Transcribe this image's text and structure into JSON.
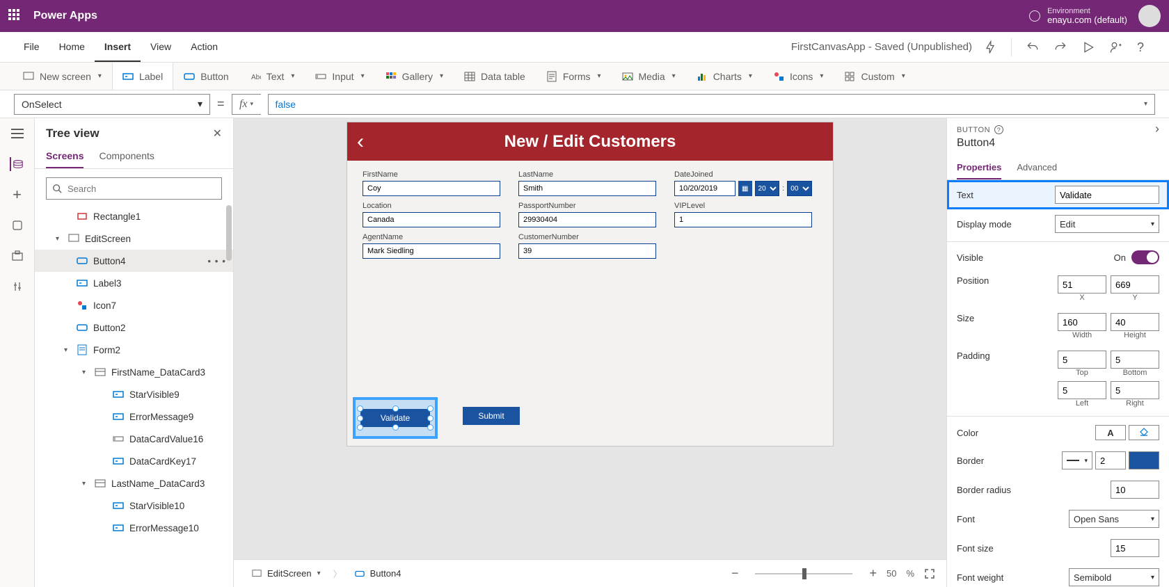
{
  "header": {
    "appName": "Power Apps",
    "envLabel": "Environment",
    "envValue": "enayu.com (default)"
  },
  "menu": {
    "items": [
      "File",
      "Home",
      "Insert",
      "View",
      "Action"
    ],
    "active": "Insert",
    "appStatus": "FirstCanvasApp - Saved (Unpublished)"
  },
  "ribbon": {
    "newScreen": "New screen",
    "label": "Label",
    "button": "Button",
    "text": "Text",
    "input": "Input",
    "gallery": "Gallery",
    "dataTable": "Data table",
    "forms": "Forms",
    "media": "Media",
    "charts": "Charts",
    "icons": "Icons",
    "custom": "Custom"
  },
  "formula": {
    "property": "OnSelect",
    "value": "false"
  },
  "tree": {
    "title": "Tree view",
    "tabs": [
      "Screens",
      "Components"
    ],
    "activeTab": "Screens",
    "searchPlaceholder": "Search",
    "items": [
      {
        "label": "Rectangle1",
        "indent": 1,
        "icon": "rect"
      },
      {
        "label": "EditScreen",
        "indent": 0,
        "icon": "screen",
        "caret": "down"
      },
      {
        "label": "Button4",
        "indent": 1,
        "icon": "button",
        "selected": true,
        "dots": true
      },
      {
        "label": "Label3",
        "indent": 1,
        "icon": "label"
      },
      {
        "label": "Icon7",
        "indent": 1,
        "icon": "icon"
      },
      {
        "label": "Button2",
        "indent": 1,
        "icon": "button"
      },
      {
        "label": "Form2",
        "indent": 1,
        "icon": "form",
        "caret": "down"
      },
      {
        "label": "FirstName_DataCard3",
        "indent": 2,
        "icon": "card",
        "caret": "down"
      },
      {
        "label": "StarVisible9",
        "indent": 3,
        "icon": "label"
      },
      {
        "label": "ErrorMessage9",
        "indent": 3,
        "icon": "label"
      },
      {
        "label": "DataCardValue16",
        "indent": 3,
        "icon": "input"
      },
      {
        "label": "DataCardKey17",
        "indent": 3,
        "icon": "label"
      },
      {
        "label": "LastName_DataCard3",
        "indent": 2,
        "icon": "card",
        "caret": "down"
      },
      {
        "label": "StarVisible10",
        "indent": 3,
        "icon": "label"
      },
      {
        "label": "ErrorMessage10",
        "indent": 3,
        "icon": "label"
      }
    ]
  },
  "stage": {
    "title": "New / Edit Customers",
    "fields": {
      "firstName": {
        "label": "FirstName",
        "value": "Coy"
      },
      "lastName": {
        "label": "LastName",
        "value": "Smith"
      },
      "dateJoined": {
        "label": "DateJoined",
        "value": "10/20/2019",
        "hour": "20",
        "min": "00"
      },
      "location": {
        "label": "Location",
        "value": "Canada"
      },
      "passport": {
        "label": "PassportNumber",
        "value": "29930404"
      },
      "vip": {
        "label": "VIPLevel",
        "value": "1"
      },
      "agent": {
        "label": "AgentName",
        "value": "Mark Siedling"
      },
      "custNum": {
        "label": "CustomerNumber",
        "value": "39"
      }
    },
    "validateBtn": "Validate",
    "submitBtn": "Submit"
  },
  "breadcrumb": {
    "screen": "EditScreen",
    "element": "Button4"
  },
  "zoom": {
    "value": "50",
    "unit": "%"
  },
  "props": {
    "type": "BUTTON",
    "name": "Button4",
    "tabs": [
      "Properties",
      "Advanced"
    ],
    "activeTab": "Properties",
    "text": {
      "label": "Text",
      "value": "Validate"
    },
    "displayMode": {
      "label": "Display mode",
      "value": "Edit"
    },
    "visible": {
      "label": "Visible",
      "value": "On"
    },
    "position": {
      "label": "Position",
      "x": "51",
      "y": "669",
      "xLabel": "X",
      "yLabel": "Y"
    },
    "size": {
      "label": "Size",
      "w": "160",
      "h": "40",
      "wLabel": "Width",
      "hLabel": "Height"
    },
    "padding": {
      "label": "Padding",
      "top": "5",
      "bottom": "5",
      "left": "5",
      "right": "5",
      "topLabel": "Top",
      "bottomLabel": "Bottom",
      "leftLabel": "Left",
      "rightLabel": "Right"
    },
    "color": {
      "label": "Color",
      "letter": "A"
    },
    "border": {
      "label": "Border",
      "value": "2"
    },
    "borderRadius": {
      "label": "Border radius",
      "value": "10"
    },
    "font": {
      "label": "Font",
      "value": "Open Sans"
    },
    "fontSize": {
      "label": "Font size",
      "value": "15"
    },
    "fontWeight": {
      "label": "Font weight",
      "value": "Semibold"
    }
  }
}
